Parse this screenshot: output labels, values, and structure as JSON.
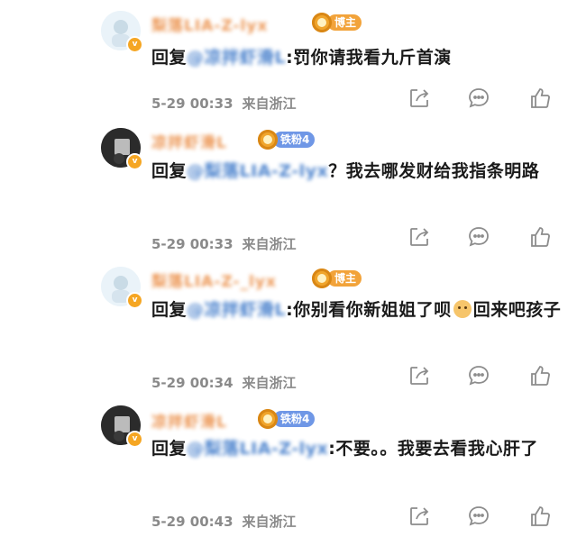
{
  "comments": [
    {
      "username": "梨落LIA-Z-lyx",
      "badge_label": "博主",
      "badge_type": "owner",
      "reply_prefix": "回复",
      "mention": "@凉拌虾滑L",
      "mention_sep": ":",
      "message": "罚你请我看九斤首演",
      "time": "5-29 00:33",
      "location": "来自浙江"
    },
    {
      "username": "凉拌虾滑L",
      "badge_label": "铁粉4",
      "badge_type": "fan",
      "reply_prefix": "回复",
      "mention": "@梨落LIA-Z-lyx",
      "mention_sep": "",
      "message": "？我去哪发财给我指条明路",
      "time": "5-29 00:33",
      "location": "来自浙江"
    },
    {
      "username": "梨落LIA-Z-_lyx",
      "badge_label": "博主",
      "badge_type": "owner",
      "reply_prefix": "回复",
      "mention": "@凉拌虾滑L",
      "mention_sep": ":",
      "message": "你别看你新姐姐了呗",
      "message_after_emoji": "回来吧孩子",
      "time": "5-29 00:34",
      "location": "来自浙江"
    },
    {
      "username": "凉拌虾滑L",
      "badge_label": "铁粉4",
      "badge_type": "fan",
      "reply_prefix": "回复",
      "mention": "@梨落LIA-Z-lyx",
      "mention_sep": ":",
      "message": "不要。。我要去看我心肝了",
      "time": "5-29 00:43",
      "location": "来自浙江"
    }
  ],
  "icons": {
    "share": "share-icon",
    "comment": "comment-icon",
    "like": "thumbs-up-icon"
  },
  "colors": {
    "username": "#e9863a",
    "mention": "#2f6fc5",
    "owner_badge": "#f2a33a",
    "fan_badge": "#6f97e6",
    "meta": "#8a8a8a"
  }
}
